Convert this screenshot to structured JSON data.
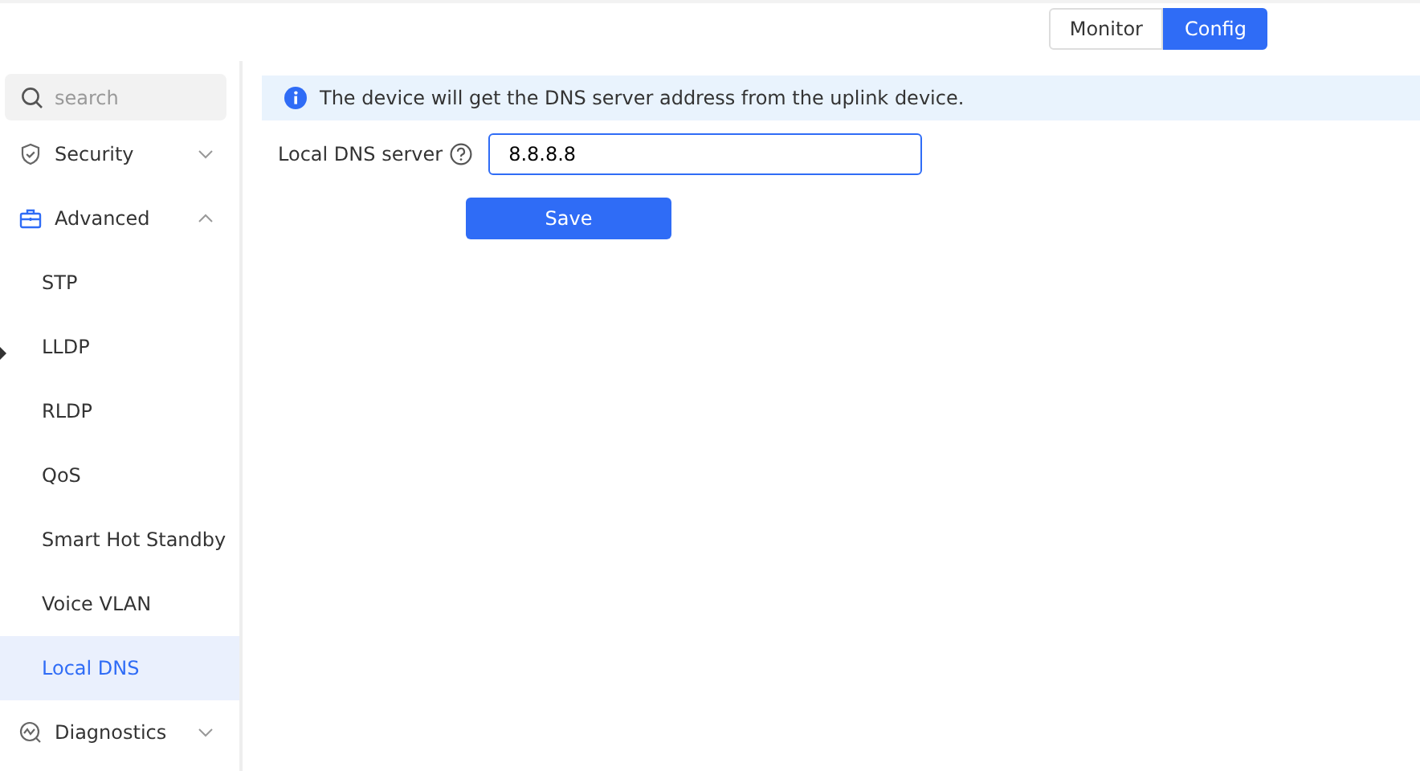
{
  "view_switch": [
    {
      "label": "Monitor",
      "selected": false
    },
    {
      "label": "Config",
      "selected": true
    }
  ],
  "sidebar": {
    "search": {
      "placeholder": "search"
    },
    "items": [
      {
        "label": "Security",
        "expanded": false
      },
      {
        "label": "Advanced",
        "expanded": true,
        "children": [
          {
            "label": "STP",
            "selected": false
          },
          {
            "label": "LLDP",
            "selected": false
          },
          {
            "label": "RLDP",
            "selected": false
          },
          {
            "label": "QoS",
            "selected": false
          },
          {
            "label": "Smart Hot Standby",
            "selected": false
          },
          {
            "label": "Voice VLAN",
            "selected": false
          },
          {
            "label": "Local DNS",
            "selected": true
          }
        ]
      },
      {
        "label": "Diagnostics",
        "expanded": false
      }
    ]
  },
  "notice": "The device will get the DNS server address from the uplink device.",
  "form": {
    "label": "Local DNS server",
    "value": "8.8.8.8",
    "button": "Save"
  }
}
